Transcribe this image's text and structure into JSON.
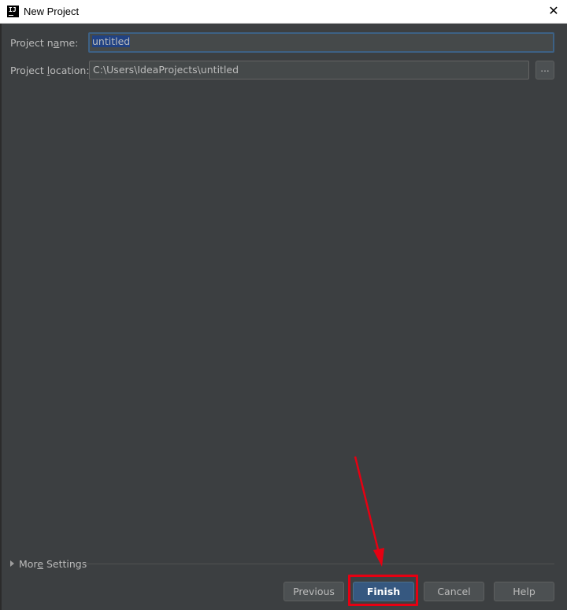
{
  "window": {
    "title": "New Project",
    "app_icon_text": "IJ",
    "close_glyph": "✕"
  },
  "form": {
    "project_name_label_pre": "Project n",
    "project_name_label_u": "a",
    "project_name_label_post": "me:",
    "project_name_value": "untitled",
    "project_location_label_pre": "Project ",
    "project_location_label_u": "l",
    "project_location_label_post": "ocation:",
    "project_location_value": "C:\\Users\\IdeaProjects\\untitled",
    "browse_label": "..."
  },
  "more_settings": {
    "label_pre": "Mor",
    "label_u": "e",
    "label_post": " Settings"
  },
  "buttons": {
    "previous": "Previous",
    "finish": "Finish",
    "cancel": "Cancel",
    "help": "Help"
  },
  "colors": {
    "background": "#3c3f41",
    "primary_button": "#365880",
    "annotation": "#e60012"
  },
  "icons": {
    "app": "intellij-idea-icon",
    "close": "close-icon",
    "expand": "triangle-right-icon",
    "annotation": "arrow-annotation-icon"
  }
}
